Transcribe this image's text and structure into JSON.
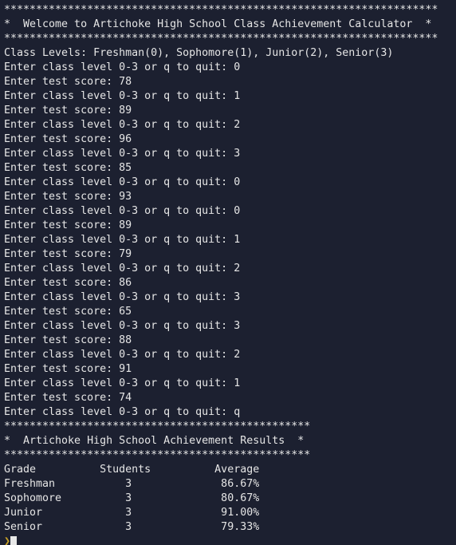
{
  "terminal": {
    "background_color": "#1c2030",
    "text_color": "#e6e6e6",
    "prompt_color": "#c9a227",
    "cursor_color": "#e8e8e8",
    "columns": 68,
    "rows": 38
  },
  "banner_top": {
    "rule_top": "********************************************************************",
    "title_line": "*  Welcome to Artichoke High School Class Achievement Calculator  *",
    "rule_bottom": "********************************************************************"
  },
  "class_levels_line": "Class Levels: Freshman(0), Sophomore(1), Junior(2), Senior(3)",
  "prompts": {
    "class_level": "Enter class level 0-3 or q to quit: ",
    "test_score": "Enter test score: "
  },
  "session": {
    "entries": [
      {
        "class_level_line": "Enter class level 0-3 or q to quit: 0",
        "test_score_line": "Enter test score: 78",
        "level": "0",
        "score": "78"
      },
      {
        "class_level_line": "Enter class level 0-3 or q to quit: 1",
        "test_score_line": "Enter test score: 89",
        "level": "1",
        "score": "89"
      },
      {
        "class_level_line": "Enter class level 0-3 or q to quit: 2",
        "test_score_line": "Enter test score: 96",
        "level": "2",
        "score": "96"
      },
      {
        "class_level_line": "Enter class level 0-3 or q to quit: 3",
        "test_score_line": "Enter test score: 85",
        "level": "3",
        "score": "85"
      },
      {
        "class_level_line": "Enter class level 0-3 or q to quit: 0",
        "test_score_line": "Enter test score: 93",
        "level": "0",
        "score": "93"
      },
      {
        "class_level_line": "Enter class level 0-3 or q to quit: 0",
        "test_score_line": "Enter test score: 89",
        "level": "0",
        "score": "89"
      },
      {
        "class_level_line": "Enter class level 0-3 or q to quit: 1",
        "test_score_line": "Enter test score: 79",
        "level": "1",
        "score": "79"
      },
      {
        "class_level_line": "Enter class level 0-3 or q to quit: 2",
        "test_score_line": "Enter test score: 86",
        "level": "2",
        "score": "86"
      },
      {
        "class_level_line": "Enter class level 0-3 or q to quit: 3",
        "test_score_line": "Enter test score: 65",
        "level": "3",
        "score": "65"
      },
      {
        "class_level_line": "Enter class level 0-3 or q to quit: 3",
        "test_score_line": "Enter test score: 88",
        "level": "3",
        "score": "88"
      },
      {
        "class_level_line": "Enter class level 0-3 or q to quit: 2",
        "test_score_line": "Enter test score: 91",
        "level": "2",
        "score": "91"
      },
      {
        "class_level_line": "Enter class level 0-3 or q to quit: 1",
        "test_score_line": "Enter test score: 74",
        "level": "1",
        "score": "74"
      }
    ],
    "quit_line": "Enter class level 0-3 or q to quit: q",
    "quit_value": "q"
  },
  "banner_results": {
    "rule_top": "************************************************",
    "title_line": "*  Artichoke High School Achievement Results  *",
    "rule_bottom": "************************************************"
  },
  "results_table": {
    "header_line": "Grade          Students          Average",
    "headers": [
      "Grade",
      "Students",
      "Average"
    ],
    "rows": [
      {
        "line": "Freshman           3              86.67%",
        "grade": "Freshman",
        "students": "3",
        "average": "86.67%"
      },
      {
        "line": "Sophomore          3              80.67%",
        "grade": "Sophomore",
        "students": "3",
        "average": "80.67%"
      },
      {
        "line": "Junior             3              91.00%",
        "grade": "Junior",
        "students": "3",
        "average": "91.00%"
      },
      {
        "line": "Senior             3              79.33%",
        "grade": "Senior",
        "students": "3",
        "average": "79.33%"
      }
    ]
  },
  "shell_prompt": {
    "symbol": "❯"
  }
}
